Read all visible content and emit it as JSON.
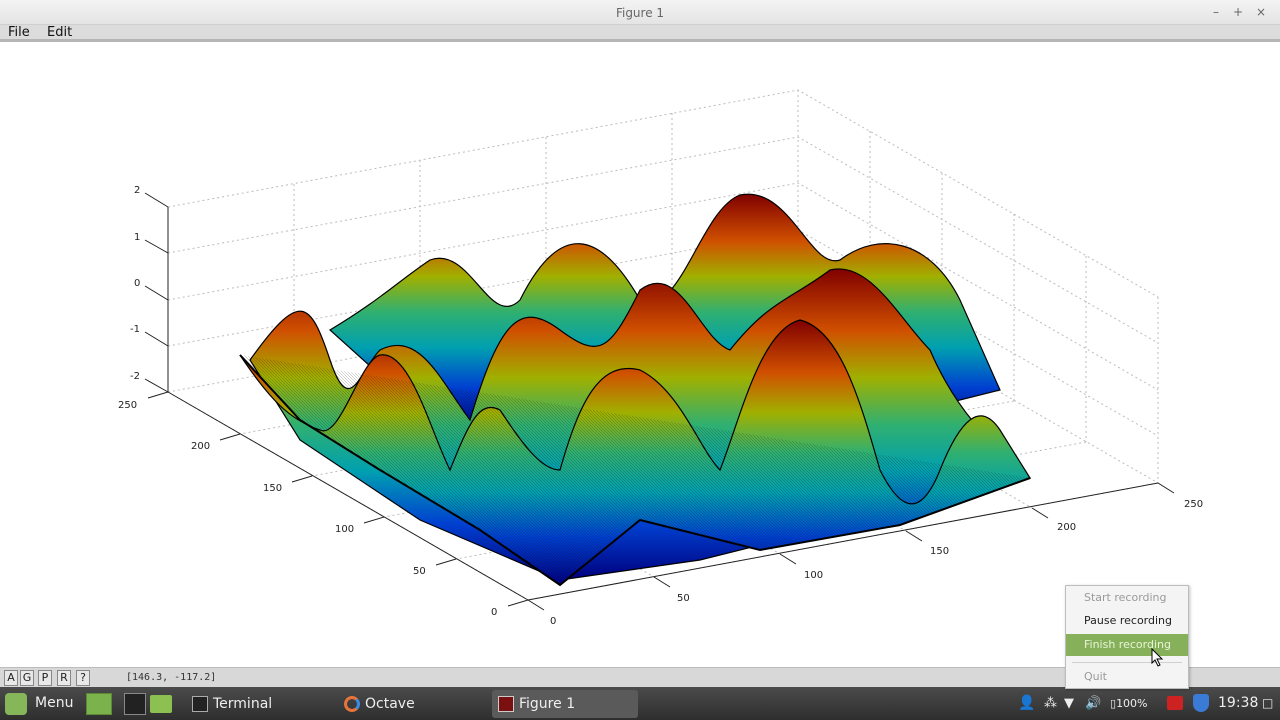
{
  "window": {
    "title": "Figure 1",
    "controls": [
      "–",
      "+",
      "×"
    ]
  },
  "menu": {
    "file": "File",
    "edit": "Edit"
  },
  "plot": {
    "z_ticks": [
      "2",
      "1",
      "0",
      "-1",
      "-2"
    ],
    "left_axis_ticks": [
      "250",
      "200",
      "150",
      "100",
      "50",
      "0"
    ],
    "right_axis_ticks": [
      "0",
      "50",
      "100",
      "150",
      "200",
      "250"
    ]
  },
  "statusbar": {
    "buttons": [
      "A",
      "G",
      "P",
      "R",
      "?"
    ],
    "coords": "[146.3, -117.2]"
  },
  "recording_menu": {
    "items": [
      {
        "label": "Start recording",
        "state": "disabled"
      },
      {
        "label": "Pause recording",
        "state": "normal"
      },
      {
        "label": "Finish recording",
        "state": "highlighted"
      },
      {
        "label": "Quit",
        "state": "disabled"
      }
    ],
    "highlight_color": "#86b05a"
  },
  "taskbar": {
    "menu_label": "Menu",
    "windows": [
      "Terminal",
      "Octave",
      "Figure 1"
    ],
    "battery": "100%",
    "clock": "19:38"
  },
  "colors": {
    "accent": "#87b55a",
    "taskbar": "#3a3a3a"
  }
}
